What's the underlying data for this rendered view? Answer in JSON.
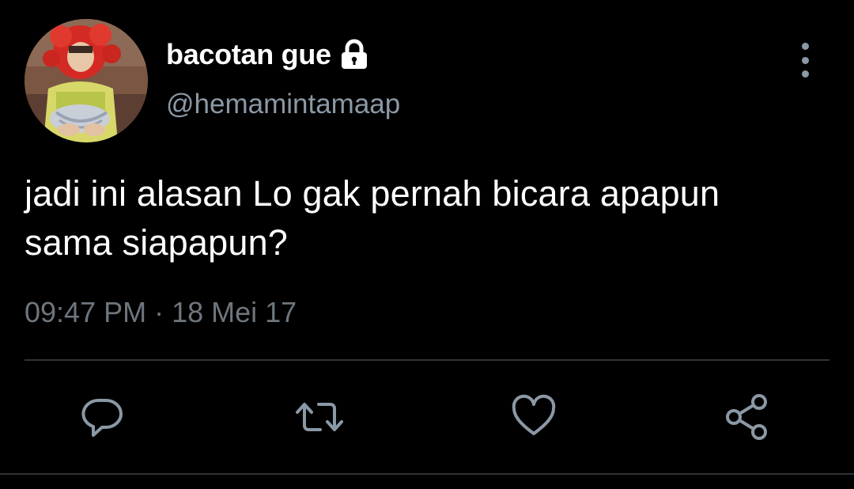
{
  "tweet": {
    "display_name": "bacotan gue",
    "handle": "@hemamintamaap",
    "text": "jadi ini alasan Lo gak pernah bicara apapun\nsama siapapun?",
    "timestamp": "09:47 PM · 18 Mei 17",
    "protected": true
  },
  "icons": {
    "lock": "lock-icon",
    "more": "more-vertical-icon",
    "reply": "reply-icon",
    "retweet": "retweet-icon",
    "like": "heart-icon",
    "share": "share-icon"
  },
  "colors": {
    "background": "#000000",
    "text_primary": "#ffffff",
    "text_secondary": "#8b98a5",
    "icon": "#8b98a5",
    "divider": "#2f3336"
  }
}
